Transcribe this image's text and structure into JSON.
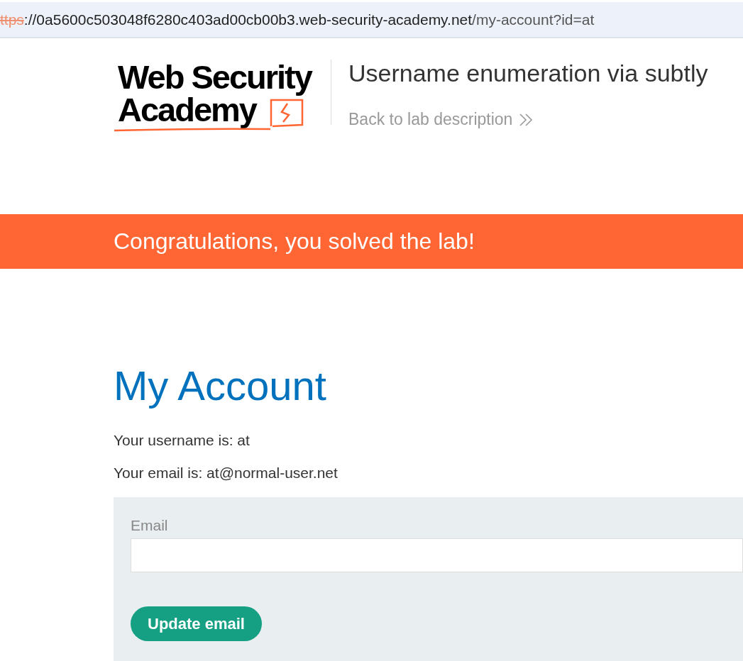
{
  "address_bar": {
    "scheme": "ttps",
    "host": "://0a5600c503048f6280c403ad00cb00b3.web-security-academy.net",
    "path": "/my-account?id=at"
  },
  "header": {
    "logo": [
      "Web Security",
      "Academy"
    ],
    "title": "Username enumeration via subtly",
    "back_link": "Back to lab description"
  },
  "banner": "Congratulations, you solved the lab!",
  "heading": "My Account",
  "details": [
    "Your username is: at",
    "Your email is: at@normal-user.net"
  ],
  "form": {
    "label": "Email",
    "button": "Update email"
  }
}
